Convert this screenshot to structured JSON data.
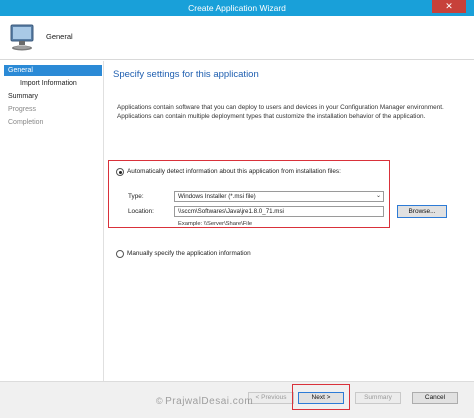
{
  "window": {
    "title": "Create Application Wizard",
    "close_glyph": "✕",
    "accent_color": "#19a0d9"
  },
  "header": {
    "title": "General",
    "icon": "computer-monitor-icon"
  },
  "nav": {
    "items": [
      {
        "label": "General",
        "state": "active"
      },
      {
        "label": "Import Information",
        "state": "sub"
      },
      {
        "label": "Summary",
        "state": "normal"
      },
      {
        "label": "Progress",
        "state": "dim"
      },
      {
        "label": "Completion",
        "state": "dim"
      }
    ]
  },
  "content": {
    "heading": "Specify settings for this application",
    "description": "Applications contain software that you can deploy to users and devices in your Configuration Manager environment. Applications can contain multiple deployment types that customize the installation behavior of the application.",
    "option_auto": {
      "label": "Automatically detect information about this application from installation files:",
      "selected": true
    },
    "type": {
      "label": "Type:",
      "value": "Windows Installer (*.msi file)"
    },
    "location": {
      "label": "Location:",
      "value": "\\\\sccm\\Softwares\\Java\\jre1.8.0_71.msi",
      "example": "Example:  \\\\Server\\Share\\File"
    },
    "browse_label": "Browse...",
    "option_manual": {
      "label": "Manually specify the application information",
      "selected": false
    }
  },
  "footer": {
    "previous_label": "< Previous",
    "next_label": "Next >",
    "summary_label": "Summary",
    "cancel_label": "Cancel"
  },
  "watermark": {
    "symbol": "©",
    "text": "PrajwalDesai.com"
  },
  "colors": {
    "highlight_red": "#d9313a",
    "nav_active": "#2b8ad6",
    "heading_blue": "#1f5fb0"
  }
}
